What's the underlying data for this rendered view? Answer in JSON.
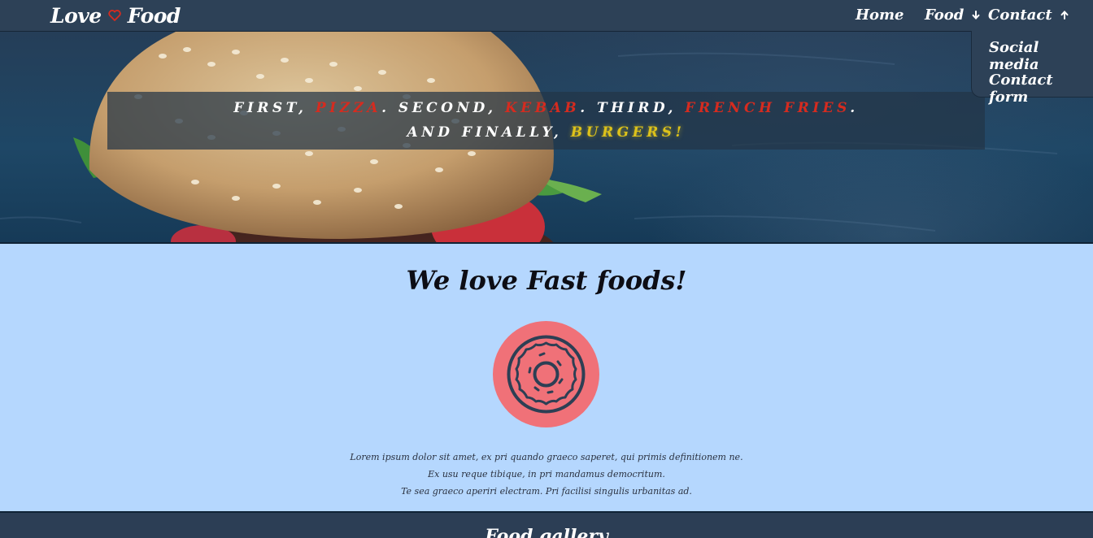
{
  "navbar": {
    "brand_left": "Love",
    "brand_right": "Food",
    "brand_icon": "heart-icon",
    "links": {
      "home": "Home",
      "food": "Food",
      "contact": "Contact"
    },
    "contact_dropdown": {
      "social": "Social media",
      "form": "Contact form"
    }
  },
  "hero": {
    "line1": {
      "p1": "FIRST, ",
      "pizza": "PIZZA",
      "p2": ". SECOND, ",
      "kebab": "KEBAB",
      "p3": ". THIRD, ",
      "fries": "FRENCH FRIES",
      "p4": "."
    },
    "line2": {
      "p1": "AND FINALLY, ",
      "burgers": "BURGERS!"
    }
  },
  "about": {
    "title": "We love Fast foods!",
    "icon": "donut-icon",
    "paragraph": [
      "Lorem ipsum dolor sit amet, ex pri quando graeco saperet, qui primis definitionem ne.",
      "Ex usu reque tibique, in pri mandamus democritum.",
      "Te sea graeco aperiri electram. Pri facilisi singulis urbanitas ad."
    ]
  },
  "gallery": {
    "title": "Food gallery"
  },
  "colors": {
    "nav_bg": "#2d4157",
    "accent_red": "#d62b1f",
    "accent_gold": "#ddc21a",
    "about_bg": "#b5d7fe",
    "donut_circle": "#f07178",
    "donut_line": "#2d3f54"
  }
}
